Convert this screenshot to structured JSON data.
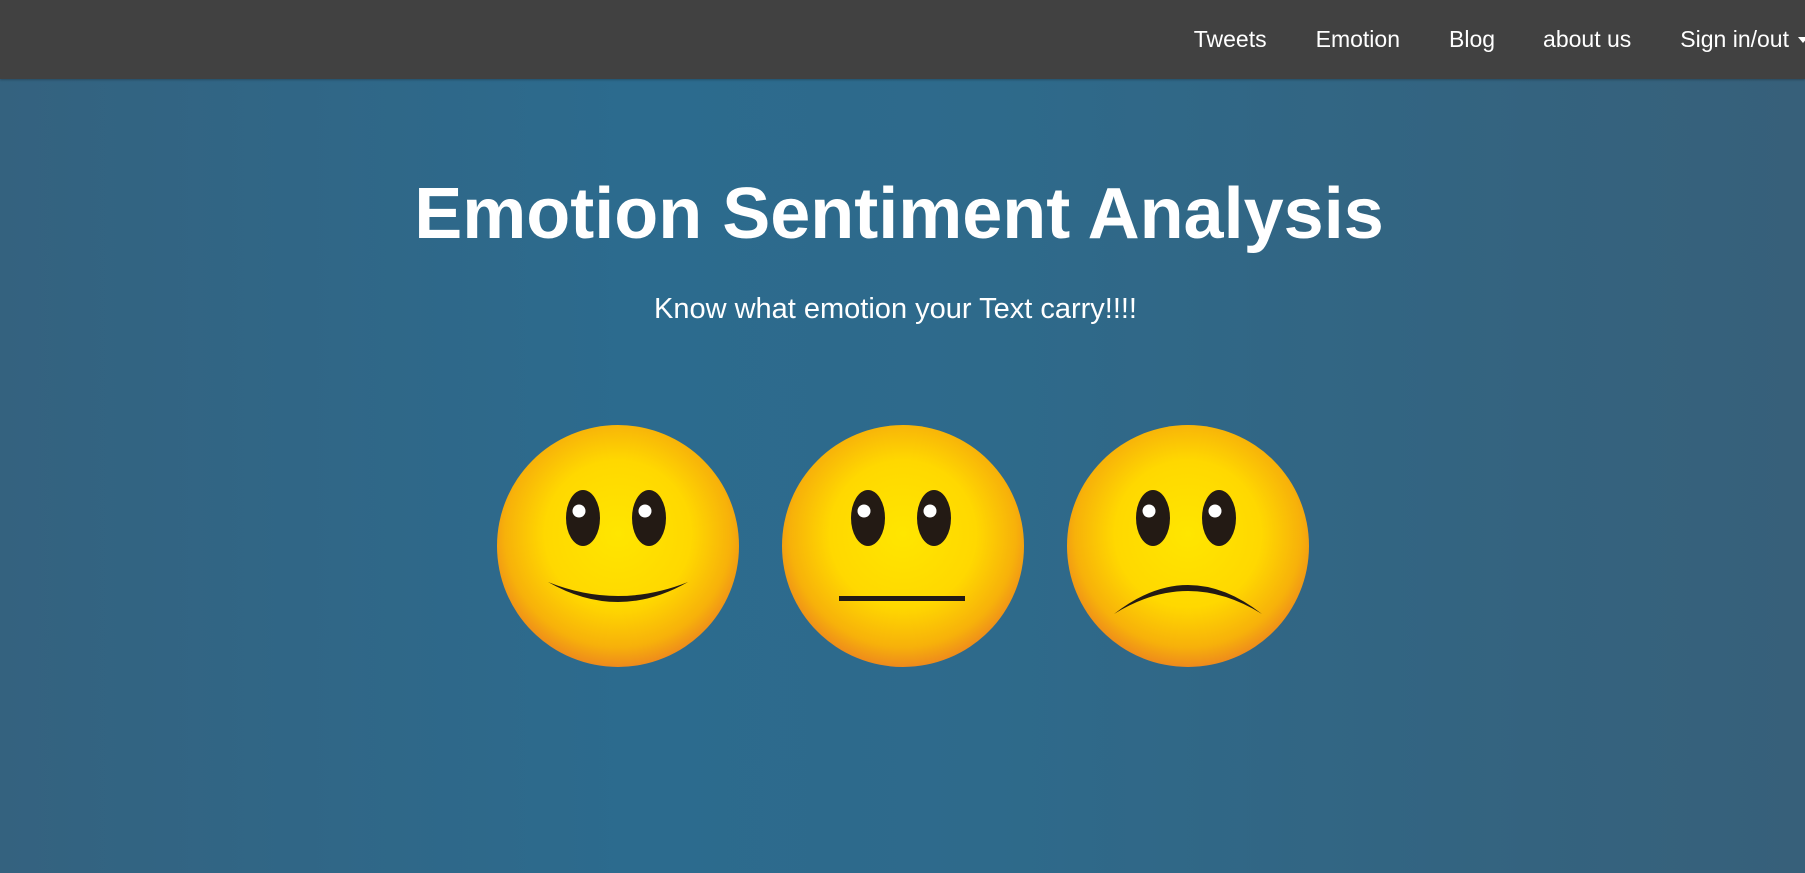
{
  "nav": {
    "items": [
      {
        "label": "Tweets"
      },
      {
        "label": "Emotion"
      },
      {
        "label": "Blog"
      },
      {
        "label": "about us"
      },
      {
        "label": "Sign in/out"
      }
    ]
  },
  "hero": {
    "title": "Emotion Sentiment Analysis",
    "subtitle": "Know what emotion your Text carry!!!!"
  },
  "emojis": [
    {
      "icon": "happy-face-icon"
    },
    {
      "icon": "neutral-face-icon"
    },
    {
      "icon": "sad-face-icon"
    }
  ],
  "colors": {
    "navbar": "#414141",
    "hero_background": "#2e6a8b",
    "emoji_center": "#ffe600",
    "emoji_edge": "#f08c1a"
  }
}
